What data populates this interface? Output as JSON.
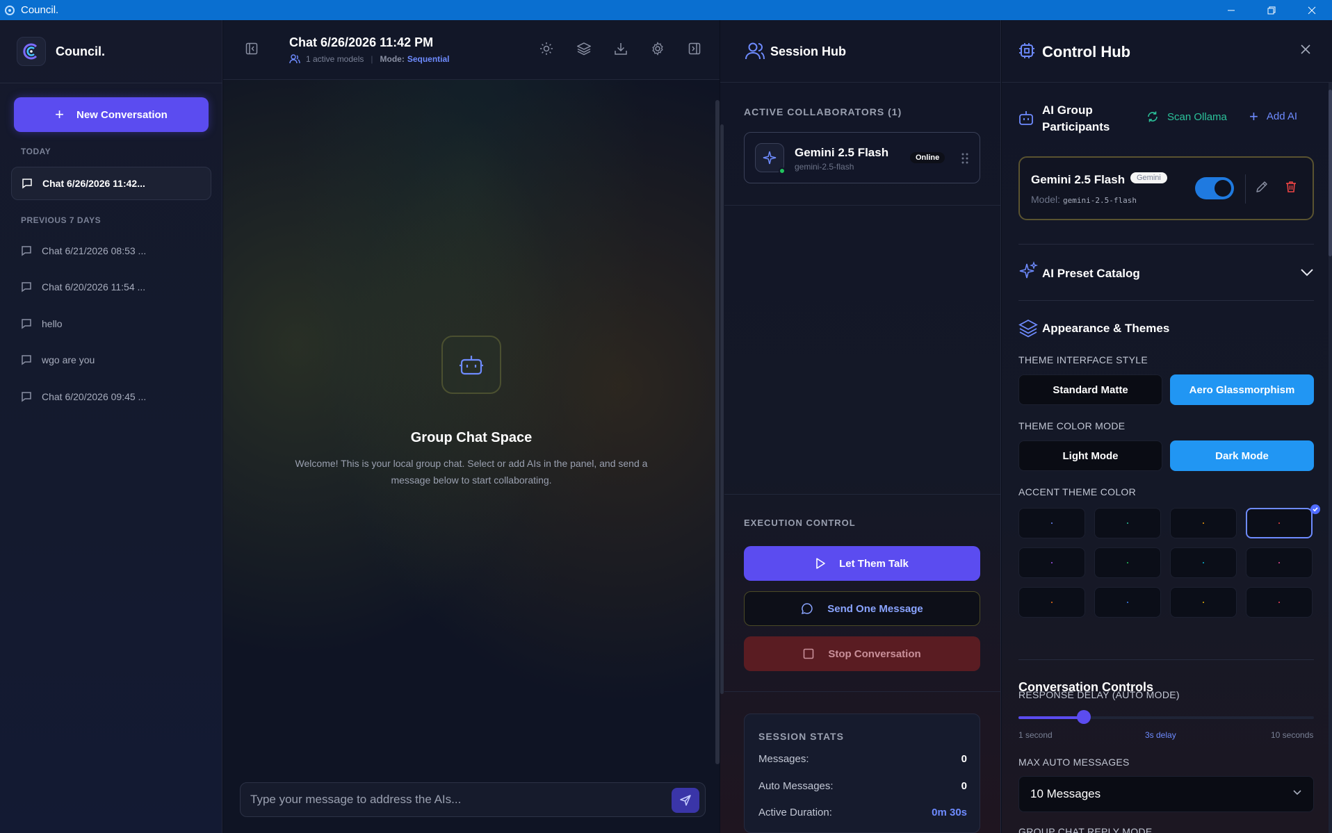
{
  "window": {
    "title": "Council.",
    "minimize_icon": "minimize-icon",
    "restore_icon": "restore-icon",
    "close_icon": "close-icon"
  },
  "sidebar": {
    "brand": "Council.",
    "new_conversation": "New Conversation",
    "today_label": "TODAY",
    "previous_label": "PREVIOUS 7 DAYS",
    "today_items": [
      {
        "label": "Chat 6/26/2026 11:42..."
      }
    ],
    "previous_items": [
      {
        "label": "Chat 6/21/2026 08:53 ..."
      },
      {
        "label": "Chat 6/20/2026 11:54 ..."
      },
      {
        "label": "hello"
      },
      {
        "label": "wgo are you"
      },
      {
        "label": "Chat 6/20/2026 09:45 ..."
      }
    ]
  },
  "chat": {
    "title": "Chat 6/26/2026 11:42 PM",
    "active_models": "1 active models",
    "mode_key": "Mode:",
    "mode_value": "Sequential",
    "empty_title": "Group Chat Space",
    "empty_text": "Welcome! This is your local group chat. Select or add AIs in the panel, and send a message below to start collaborating.",
    "input_placeholder": "Type your message to address the AIs..."
  },
  "session_hub": {
    "title": "Session Hub",
    "collaborators_label": "ACTIVE COLLABORATORS (1)",
    "collaborator": {
      "name": "Gemini 2.5 Flash",
      "model": "gemini-2.5-flash",
      "status": "Online"
    },
    "execution_label": "EXECUTION CONTROL",
    "let_them_talk": "Let Them Talk",
    "send_one": "Send One Message",
    "stop": "Stop Conversation",
    "stats": {
      "title": "SESSION STATS",
      "messages_label": "Messages:",
      "messages_value": "0",
      "auto_label": "Auto Messages:",
      "auto_value": "0",
      "duration_label": "Active Duration:",
      "duration_value": "0m 30s"
    }
  },
  "control_hub": {
    "title": "Control Hub",
    "group_title": "AI Group Participants",
    "scan_ollama": "Scan Ollama",
    "add_ai": "Add AI",
    "participant": {
      "name": "Gemini 2.5 Flash",
      "tag": "Gemini",
      "model_label": "Model:",
      "model": "gemini-2.5-flash",
      "enabled": true
    },
    "preset_catalog": "AI Preset Catalog",
    "appearance_title": "Appearance & Themes",
    "theme_style_label": "THEME INTERFACE STYLE",
    "theme_style_options": [
      "Standard Matte",
      "Aero Glassmorphism"
    ],
    "theme_style_selected": "Aero Glassmorphism",
    "color_mode_label": "THEME COLOR MODE",
    "color_mode_options": [
      "Light Mode",
      "Dark Mode"
    ],
    "color_mode_selected": "Dark Mode",
    "accent_label": "ACCENT THEME COLOR",
    "accent_colors": [
      "#6e8bff",
      "#2bc29a",
      "#f59e0b",
      "#ef4444",
      "#a855f7",
      "#22c55e",
      "#06b6d4",
      "#ec4899",
      "#f97316",
      "#3b82f6",
      "#eab308",
      "#f43f5e"
    ],
    "accent_selected_index": 3,
    "conversation_controls": "Conversation Controls",
    "response_delay_label": "RESPONSE DELAY (AUTO MODE)",
    "delay_min": "1 second",
    "delay_value_label": "3s delay",
    "delay_max": "10 seconds",
    "delay_fraction": 0.222,
    "max_auto_label": "MAX AUTO MESSAGES",
    "max_auto_value": "10 Messages",
    "reply_mode_label": "GROUP CHAT REPLY MODE"
  }
}
